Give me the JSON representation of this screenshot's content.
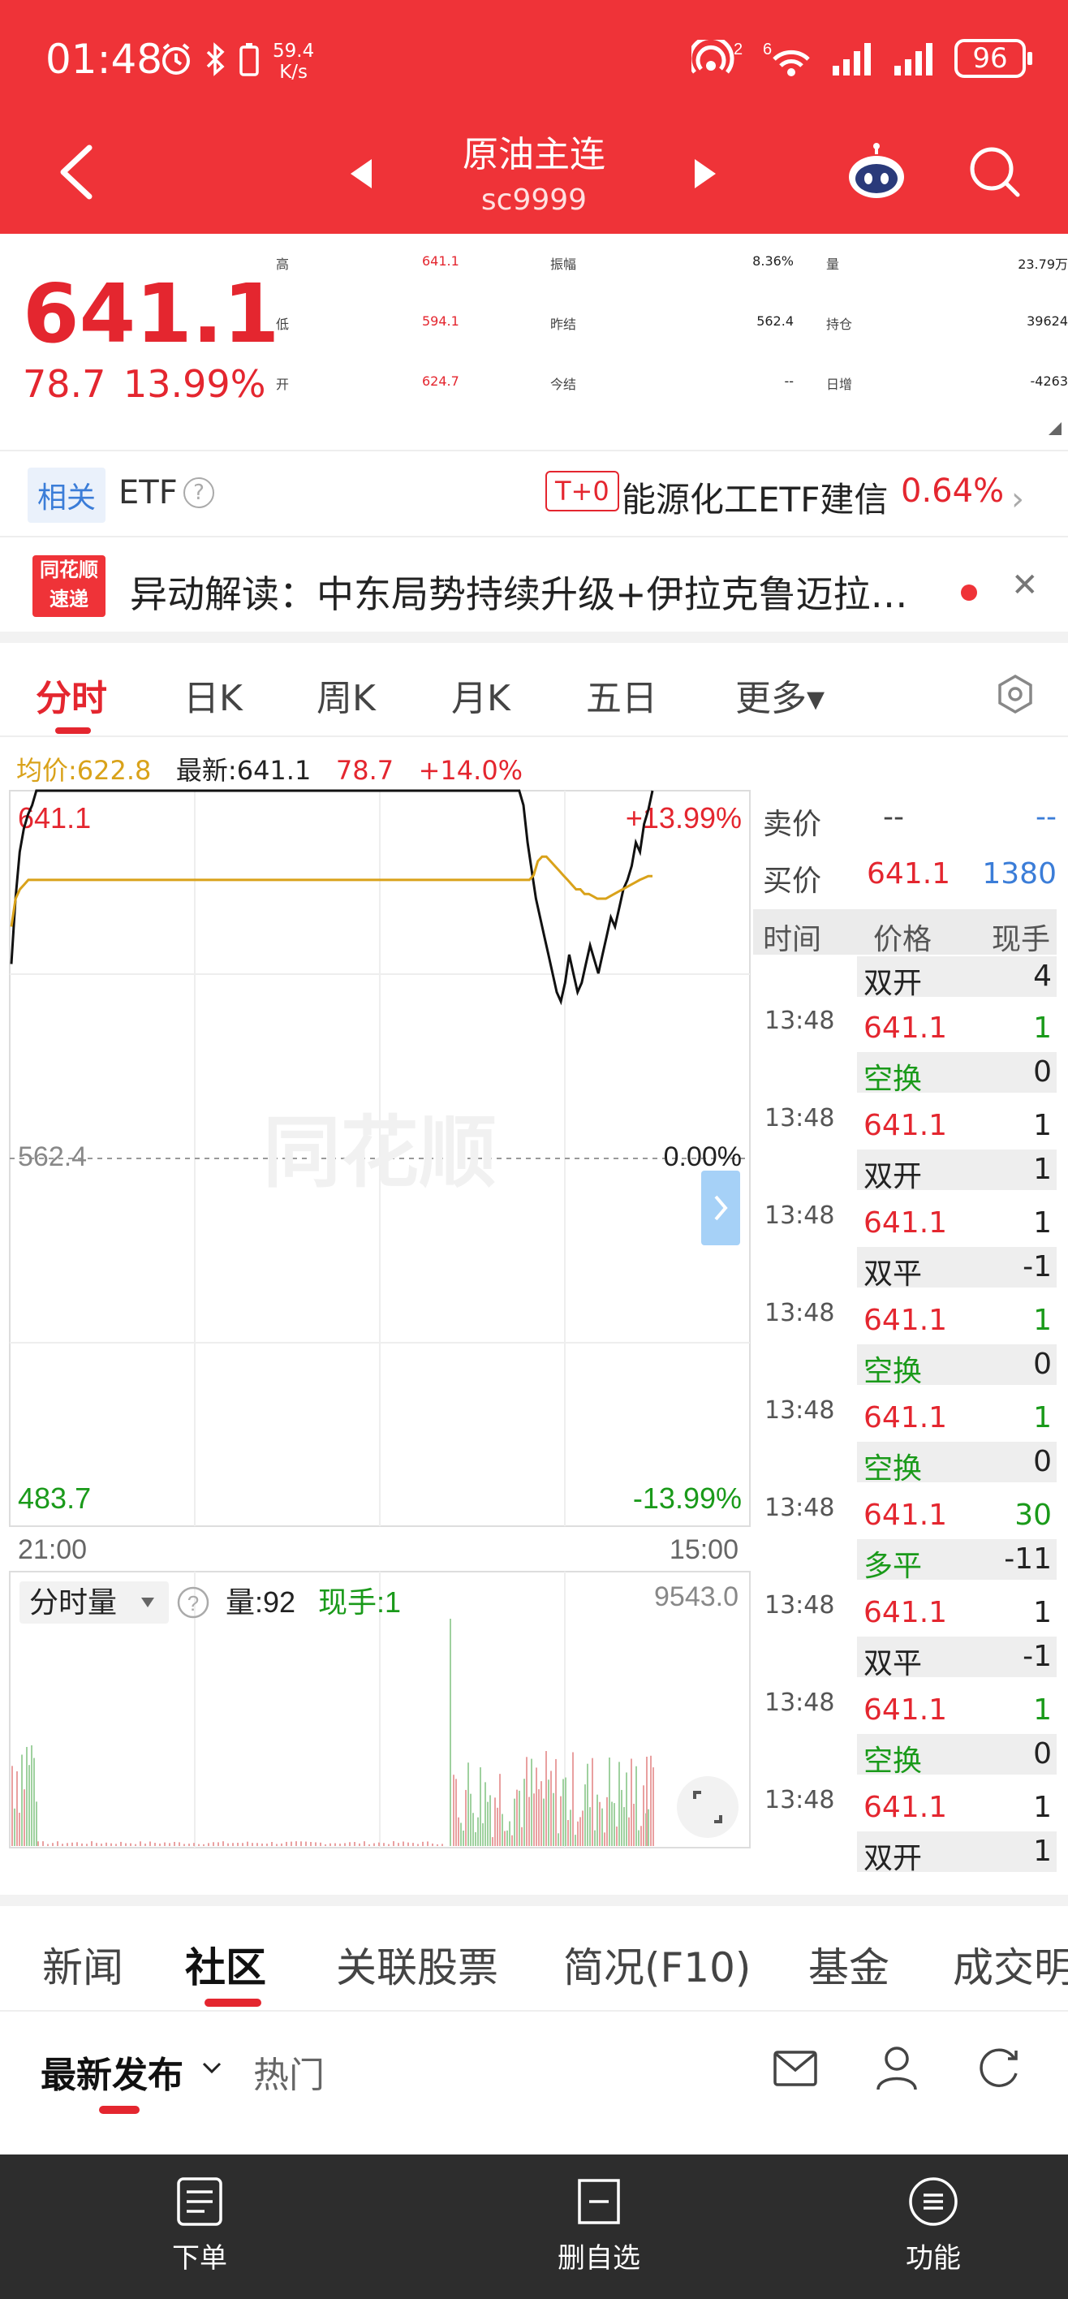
{
  "status_bar": {
    "time": "01:48",
    "net_speed_value": "59.4",
    "net_speed_unit": "K/s",
    "battery": "96",
    "sim_labels": [
      "2",
      "6"
    ]
  },
  "header": {
    "title": "原油主连",
    "subtitle": "sc9999",
    "back_icon": "back-arrow-icon",
    "prev_icon": "caret-left-icon",
    "next_icon": "caret-right-icon",
    "robot_icon": "assistant-robot-icon",
    "search_icon": "search-icon",
    "bg_color": "#ef3338"
  },
  "quote": {
    "price": "641.1",
    "change": "78.7",
    "change_pct": "13.99%",
    "fields": [
      {
        "label": "高",
        "value": "641.1",
        "red": true
      },
      {
        "label": "低",
        "value": "594.1",
        "red": true
      },
      {
        "label": "开",
        "value": "624.7",
        "red": true
      },
      {
        "label": "振幅",
        "value": "8.36%",
        "red": false
      },
      {
        "label": "昨结",
        "value": "562.4",
        "red": false
      },
      {
        "label": "今结",
        "value": "--",
        "red": false
      },
      {
        "label": "量",
        "value": "23.79万",
        "red": false
      },
      {
        "label": "持仓",
        "value": "39624",
        "red": false
      },
      {
        "label": "日增",
        "value": "-4263",
        "red": false
      }
    ],
    "up_color": "#e4262f"
  },
  "etf": {
    "tag": "相关",
    "label": "ETF",
    "help": "?",
    "t0": "T+0",
    "name": "能源化工ETF建信",
    "pct": "0.64%"
  },
  "news": {
    "logo_line1": "同花顺",
    "logo_line2": "速递",
    "text": "异动解读：中东局势持续升级+伊拉克鲁迈拉…"
  },
  "chart_tabs": [
    "分时",
    "日K",
    "周K",
    "月K",
    "五日",
    "更多▾"
  ],
  "chart_info": {
    "avg": "均价:622.8",
    "latest": "最新:641.1",
    "chg": "78.7",
    "pct": "+14.0%"
  },
  "chart_data": {
    "type": "line",
    "x_labels": [
      "21:00",
      "15:00"
    ],
    "y_top_label": "641.1",
    "y_mid_label": "562.4",
    "y_bottom_label": "483.7",
    "right_top_label": "+13.99%",
    "right_mid_label": "0.00%",
    "right_bottom_label": "-13.99%",
    "ylim": [
      483.7,
      641.1
    ],
    "series": [
      {
        "values": [
          604,
          618,
          628,
          633,
          636,
          638,
          641.1,
          641.1,
          641.1,
          641.1,
          641.1,
          641.1,
          641.1,
          641.1,
          641.1,
          641.1,
          641.1,
          641.1,
          641.1,
          641.1,
          641.1,
          641.1,
          641.1,
          641.1,
          641.1,
          641.1,
          641.1,
          641.1,
          641.1,
          641.1,
          641.1,
          641.1,
          641.1,
          641.1,
          641.1,
          641.1,
          641.1,
          641.1,
          641.1,
          641.1,
          641.1,
          641.1,
          641.1,
          641.1,
          641.1,
          641.1,
          641.1,
          641.1,
          641.1,
          641.1,
          641.1,
          641.1,
          641.1,
          641.1,
          641.1,
          641.1,
          641.1,
          641.1,
          641.1,
          641.1,
          641.1,
          641.1,
          641.1,
          641.1,
          641.1,
          641.1,
          641.1,
          641.1,
          641.1,
          641.1,
          641.1,
          641.1,
          641.1,
          641.1,
          641.1,
          641.1,
          641.1,
          641.1,
          641.1,
          641.1,
          641.1,
          641.1,
          641.1,
          641.1,
          641.1,
          641.1,
          641.1,
          641.1,
          641.1,
          641.1,
          641.1,
          641.1,
          641.1,
          641.1,
          641.1,
          641.1,
          641.1,
          641.1,
          641.1,
          641.1,
          641.1,
          641.1,
          641.1,
          641.1,
          641.1,
          641.1,
          641.1,
          641.1,
          641.1,
          641.1,
          641.1,
          641.1,
          641.1,
          641.1,
          641.1,
          641.1,
          641.1,
          641.1,
          641.1,
          641.1,
          641.1,
          641.1,
          641.1,
          638,
          630,
          624,
          618,
          614,
          610,
          606,
          602,
          598,
          596,
          600,
          606,
          602,
          598,
          600,
          604,
          608,
          605,
          602,
          606,
          610,
          614,
          612,
          616,
          620,
          622,
          625,
          630,
          628,
          634,
          637,
          641.1
        ]
      },
      {
        "values": [
          612,
          618,
          620,
          621,
          622,
          622,
          622,
          622,
          622,
          622,
          622,
          622,
          622,
          622,
          622,
          622,
          622,
          622,
          622,
          622,
          622,
          622,
          622,
          622,
          622,
          622,
          622,
          622,
          622,
          622,
          622,
          622,
          622,
          622,
          622,
          622,
          622,
          622,
          622,
          622,
          622,
          622,
          622,
          622,
          622,
          622,
          622,
          622,
          622,
          622,
          622,
          622,
          622,
          622,
          622,
          622,
          622,
          622,
          622,
          622,
          622,
          622,
          622,
          622,
          622,
          622,
          622,
          622,
          622,
          622,
          622,
          622,
          622,
          622,
          622,
          622,
          622,
          622,
          622,
          622,
          622,
          622,
          622,
          622,
          622,
          622,
          622,
          622,
          622,
          622,
          622,
          622,
          622,
          622,
          622,
          622,
          622,
          622,
          622,
          622,
          622,
          622,
          622,
          622,
          622,
          622,
          622,
          622,
          622,
          622,
          622,
          622,
          622,
          622,
          622,
          622,
          622,
          622,
          622,
          622,
          622,
          622,
          622,
          623,
          626,
          627,
          627,
          626,
          625,
          624,
          623,
          622,
          621,
          620,
          620,
          619,
          619,
          618.5,
          618,
          618,
          618,
          618.5,
          619,
          619.5,
          620,
          620.5,
          621,
          621.5,
          622,
          622.4,
          622.8,
          622.8
        ]
      }
    ],
    "colors": {
      "price": "#111111",
      "avg": "#d9a21a"
    }
  },
  "volume": {
    "label": "分时量",
    "help": "?",
    "qty": "量:92",
    "hand": "现手:1",
    "max": "9543.0"
  },
  "order_book": {
    "ask_label": "卖价",
    "ask_price": "--",
    "ask_qty": "--",
    "bid_label": "买价",
    "bid_price": "641.1",
    "bid_qty": "1380"
  },
  "trade_header": [
    "时间",
    "价格",
    "现手"
  ],
  "trades_top": {
    "type": "双开",
    "qty": "4"
  },
  "trades": [
    {
      "time": "13:48",
      "price": "641.1",
      "hand": "1",
      "hand_green": true,
      "type": "空换",
      "type_green": true,
      "change": "0"
    },
    {
      "time": "13:48",
      "price": "641.1",
      "hand": "1",
      "hand_green": false,
      "type": "双开",
      "type_green": false,
      "change": "1"
    },
    {
      "time": "13:48",
      "price": "641.1",
      "hand": "1",
      "hand_green": false,
      "type": "双平",
      "type_green": false,
      "change": "-1"
    },
    {
      "time": "13:48",
      "price": "641.1",
      "hand": "1",
      "hand_green": true,
      "type": "空换",
      "type_green": true,
      "change": "0"
    },
    {
      "time": "13:48",
      "price": "641.1",
      "hand": "1",
      "hand_green": true,
      "type": "空换",
      "type_green": true,
      "change": "0"
    },
    {
      "time": "13:48",
      "price": "641.1",
      "hand": "30",
      "hand_green": true,
      "type": "多平",
      "type_green": true,
      "change": "-11"
    },
    {
      "time": "13:48",
      "price": "641.1",
      "hand": "1",
      "hand_green": false,
      "type": "双平",
      "type_green": false,
      "change": "-1"
    },
    {
      "time": "13:48",
      "price": "641.1",
      "hand": "1",
      "hand_green": true,
      "type": "空换",
      "type_green": true,
      "change": "0"
    },
    {
      "time": "13:48",
      "price": "641.1",
      "hand": "1",
      "hand_green": false,
      "type": "双开",
      "type_green": false,
      "change": "1"
    }
  ],
  "lower_tabs": [
    "新闻",
    "社区",
    "关联股票",
    "简况(F10)",
    "基金",
    "成交明"
  ],
  "sub_tabs": {
    "latest": "最新发布",
    "hot": "热门"
  },
  "bottom_bar": [
    {
      "label": "下单",
      "icon": "order-doc-icon"
    },
    {
      "label": "删自选",
      "icon": "remove-watchlist-icon"
    },
    {
      "label": "功能",
      "icon": "menu-circle-icon"
    }
  ],
  "watermark": "同花顺"
}
